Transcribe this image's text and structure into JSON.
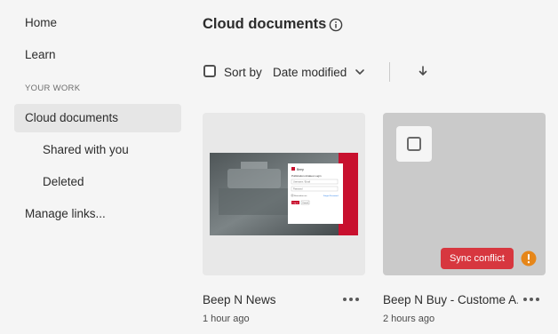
{
  "sidebar": {
    "home": "Home",
    "learn": "Learn",
    "section_label": "YOUR WORK",
    "cloud_documents": "Cloud documents",
    "shared_with_you": "Shared with you",
    "deleted": "Deleted",
    "manage_links": "Manage links..."
  },
  "header": {
    "title": "Cloud documents",
    "info_icon": "info-icon"
  },
  "toolbar": {
    "sort_label": "Sort by",
    "sort_value": "Date modified",
    "sort_direction_icon": "arrow-down-icon"
  },
  "documents": [
    {
      "name": "Beep N News",
      "modified": "1 hour ago"
    },
    {
      "name": "Beep N Buy - Custome A...",
      "modified": "2 hours ago",
      "badge": "Sync conflict",
      "badge_icon": "warning-icon"
    }
  ],
  "preview_text": {
    "brand": "Beep",
    "login_title": "Publication-Intakes Login",
    "username_placeholder": "Username / Email",
    "password_placeholder": "Password",
    "remember": "Remember me",
    "forgot": "Forgot Password",
    "login_btn": "Log in",
    "cancel_btn": "Cancel"
  },
  "colors": {
    "accent_red": "#d7373f",
    "warning_orange": "#e68619",
    "active_nav_bg": "#e6e6e6",
    "thumb_bg": "#e8e8e8",
    "conflict_thumb_bg": "#cacaca"
  }
}
